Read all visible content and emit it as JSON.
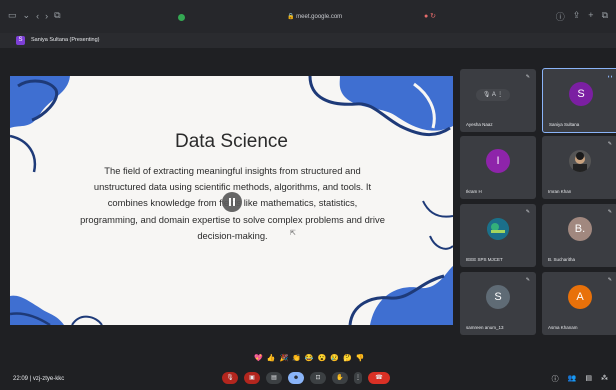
{
  "browser": {
    "url": "meet.google.com",
    "left_icons": [
      "sidebar-icon",
      "chevron-down-icon",
      "back-icon",
      "forward-icon",
      "tabs-icon"
    ],
    "right_icons": [
      "info-icon",
      "share-icon",
      "new-tab-icon",
      "copy-icon"
    ]
  },
  "presenting": {
    "badge": "S",
    "label": "Saniya Sultana (Presenting)"
  },
  "slide": {
    "title": "Data Science",
    "body": "The field of extracting meaningful insights from structured and unstructured data using scientific methods, algorithms, and tools. It combines knowledge from fields like mathematics, statistics, programming, and domain expertise to solve complex problems and drive decision-making."
  },
  "participants": [
    {
      "name": "Ayesha Naaz",
      "initial": "A",
      "color": "#6b6e75",
      "type": "pill"
    },
    {
      "name": "Saniya Sultana",
      "initial": "S",
      "color": "#7b1fa2",
      "type": "avatar",
      "active": true
    },
    {
      "name": "Ikram H",
      "initial": "I",
      "color": "#8e24aa",
      "type": "avatar"
    },
    {
      "name": "Imran Khan",
      "initial": "",
      "color": "#555",
      "type": "photo"
    },
    {
      "name": "IEEE SPS MJCET",
      "initial": "",
      "color": "#1a7f7a",
      "type": "logo"
    },
    {
      "name": "B. Sucharitha",
      "initial": "B.",
      "color": "#a1887f",
      "type": "avatar"
    },
    {
      "name": "samreen anum_13",
      "initial": "S",
      "color": "#5f6b75",
      "type": "avatar"
    },
    {
      "name": "Asma Khanam",
      "initial": "A",
      "color": "#e8710a",
      "type": "avatar"
    }
  ],
  "reactions": [
    "💖",
    "👍",
    "🎉",
    "👏",
    "😂",
    "😮",
    "😢",
    "🤔",
    "👎"
  ],
  "meeting": {
    "time": "22:09",
    "code": "vzj-ztye-kkc"
  },
  "colors": {
    "accent": "#8ab4f8",
    "end_call": "#d93025",
    "slide_blue": "#3f6fd1",
    "slide_navy": "#1e3a78"
  }
}
